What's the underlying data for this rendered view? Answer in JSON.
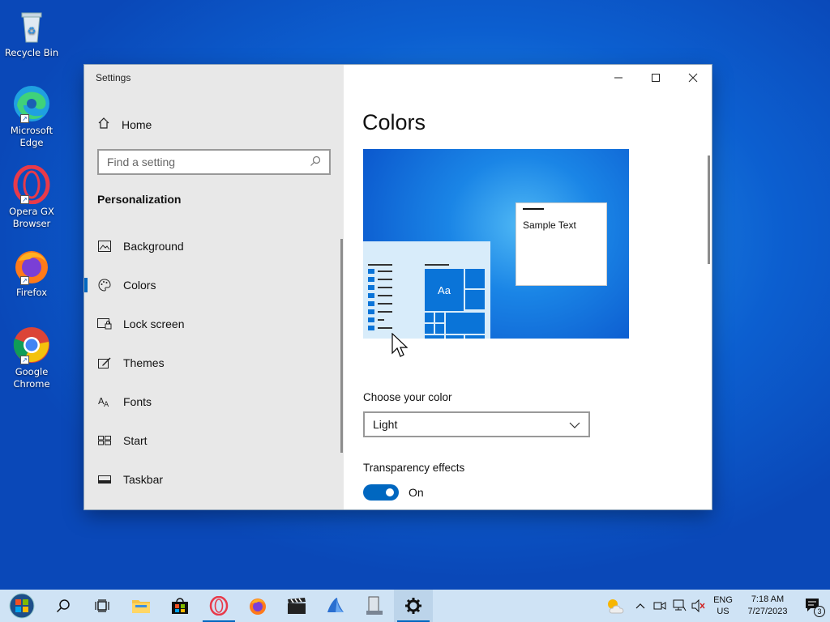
{
  "desktop": {
    "icons": [
      {
        "label": "Recycle Bin"
      },
      {
        "label": "Microsoft Edge"
      },
      {
        "label": "Opera GX Browser"
      },
      {
        "label": "Firefox"
      },
      {
        "label": "Google Chrome"
      }
    ]
  },
  "window": {
    "title": "Settings",
    "sidebar": {
      "home_label": "Home",
      "search_placeholder": "Find a setting",
      "section_title": "Personalization",
      "items": [
        {
          "label": "Background",
          "icon": "image-icon"
        },
        {
          "label": "Colors",
          "icon": "palette-icon",
          "active": true
        },
        {
          "label": "Lock screen",
          "icon": "lock-screen-icon"
        },
        {
          "label": "Themes",
          "icon": "themes-icon"
        },
        {
          "label": "Fonts",
          "icon": "fonts-icon"
        },
        {
          "label": "Start",
          "icon": "start-icon"
        },
        {
          "label": "Taskbar",
          "icon": "taskbar-icon"
        }
      ]
    },
    "content": {
      "page_title": "Colors",
      "preview_sample_text": "Sample Text",
      "preview_tile_text": "Aa",
      "choose_color_label": "Choose your color",
      "choose_color_value": "Light",
      "transparency_label": "Transparency effects",
      "transparency_state": "On"
    }
  },
  "taskbar": {
    "tray": {
      "lang_top": "ENG",
      "lang_bottom": "US",
      "time": "7:18 AM",
      "date": "7/27/2023",
      "notifications": "3"
    }
  },
  "colors": {
    "accent": "#0067c0",
    "sidebar_bg": "#e8e8e8",
    "taskbar_bg": "#cfe3f5"
  }
}
